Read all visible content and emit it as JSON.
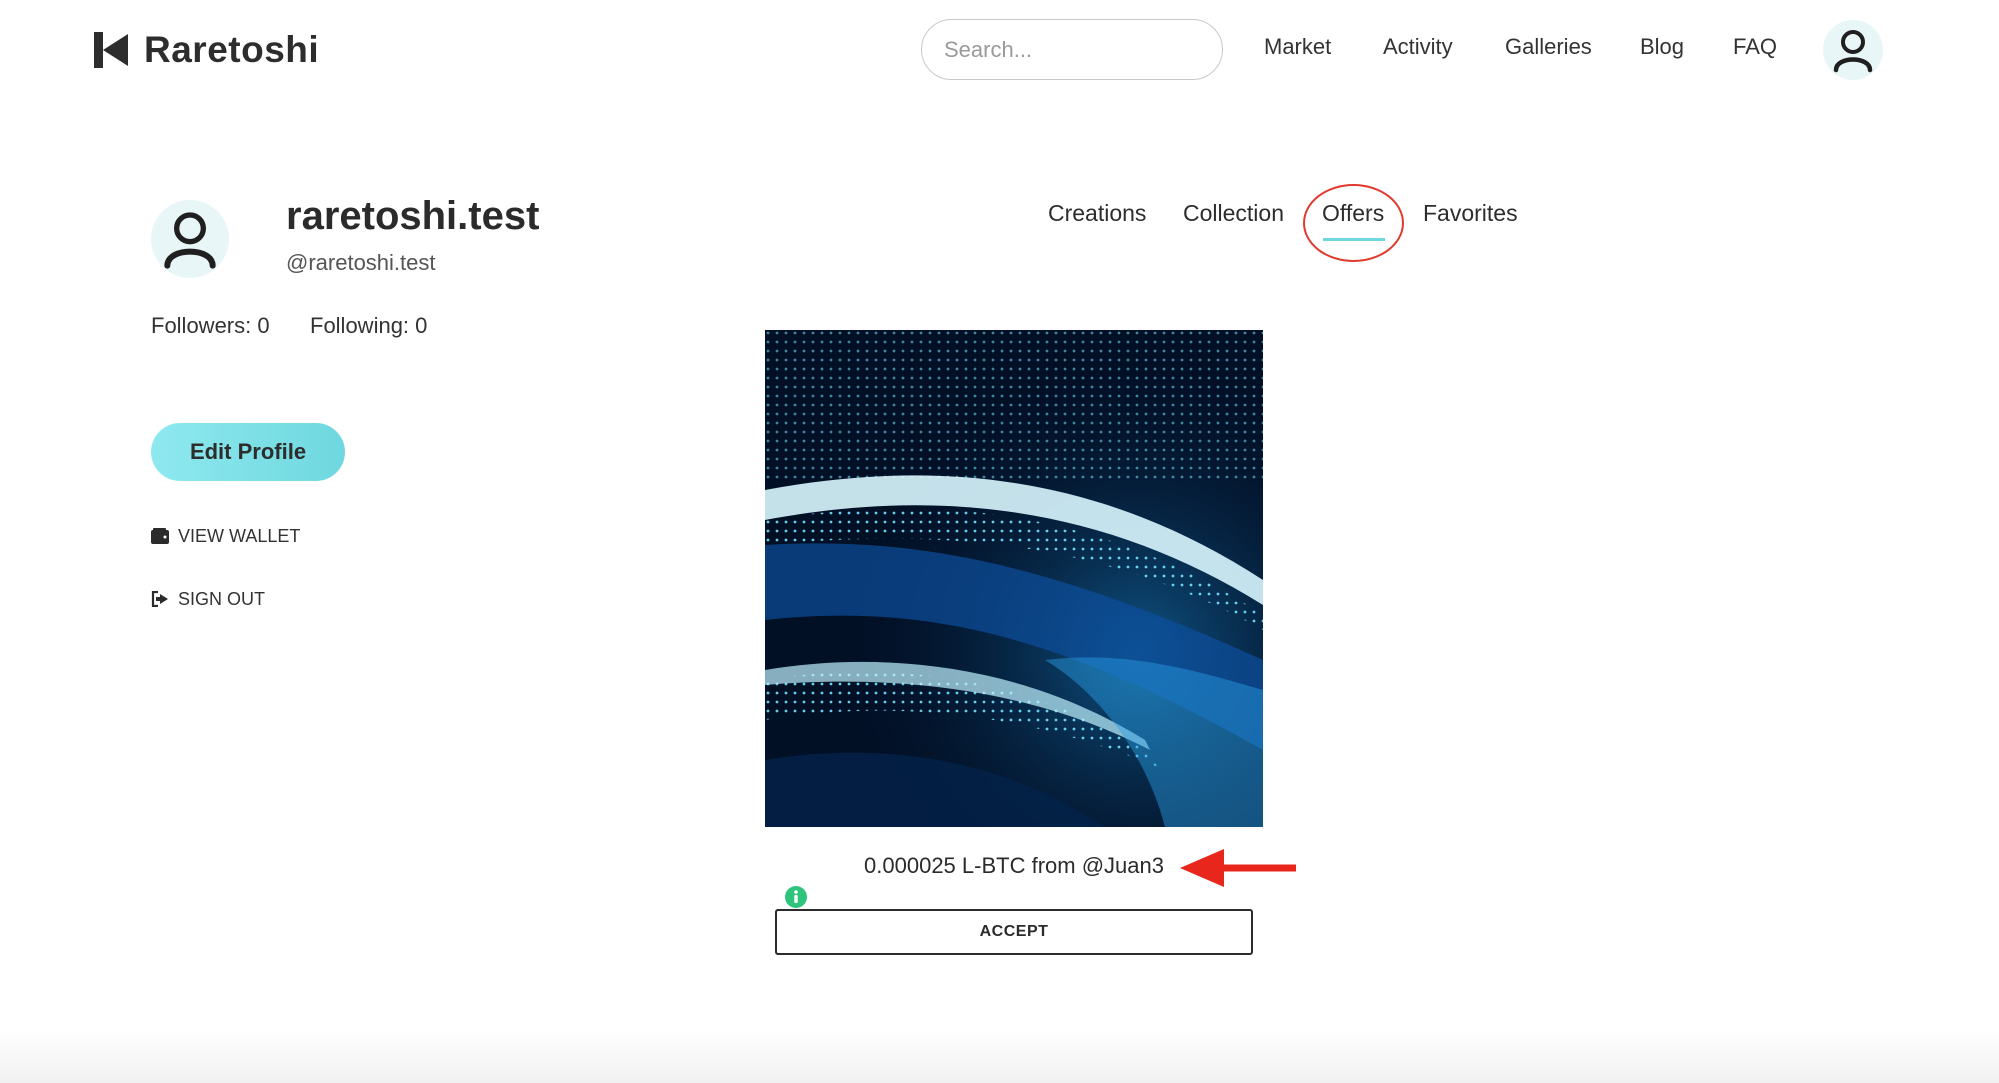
{
  "header": {
    "logo_text": "Raretoshi",
    "search_placeholder": "Search...",
    "nav": [
      "Market",
      "Activity",
      "Galleries",
      "Blog",
      "FAQ"
    ]
  },
  "profile": {
    "name": "raretoshi.test",
    "handle": "@raretoshi.test",
    "followers": "Followers: 0",
    "following": "Following: 0",
    "edit_label": "Edit Profile",
    "view_wallet": "VIEW WALLET",
    "sign_out": "SIGN OUT"
  },
  "tabs": [
    "Creations",
    "Collection",
    "Offers",
    "Favorites"
  ],
  "active_tab": "Offers",
  "offer": {
    "text": "0.000025 L-BTC from @Juan3",
    "accept_label": "ACCEPT"
  },
  "colors": {
    "accent": "#6fd7df",
    "highlight": "#e03a2f",
    "info": "#2fc47b"
  }
}
